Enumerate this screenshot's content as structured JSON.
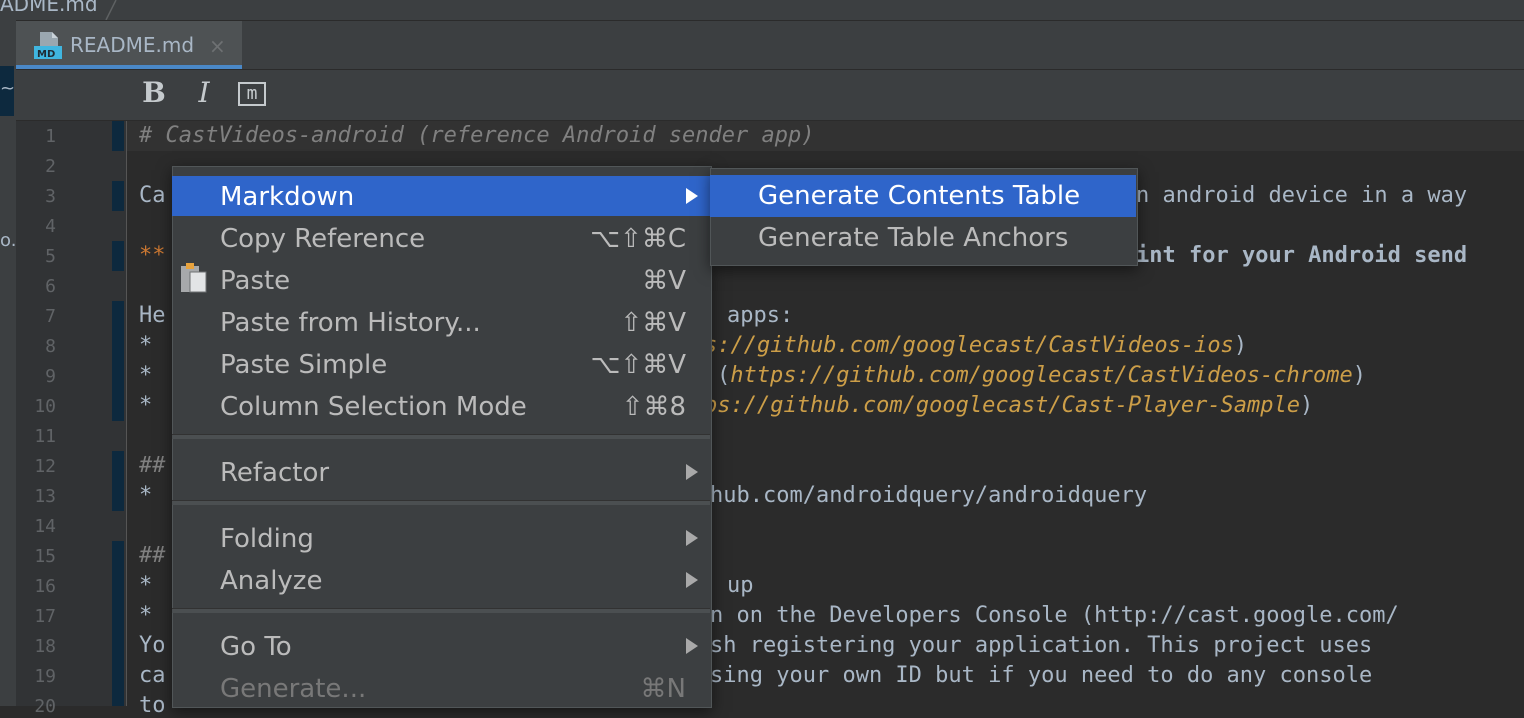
{
  "breadcrumb": {
    "file": "ADME.md"
  },
  "left_strip": {
    "mark1": "~",
    "mark2": "o."
  },
  "tab": {
    "label": "README.md",
    "close": "×",
    "icon": "markdown-file-icon",
    "icon_text": "MD"
  },
  "toolbar": {
    "bold": "B",
    "italic": "I",
    "mono": "m"
  },
  "editor": {
    "line_numbers": [
      "1",
      "2",
      "3",
      "4",
      "5",
      "6",
      "7",
      "8",
      "9",
      "10",
      "11",
      "12",
      "13",
      "14",
      "15",
      "16",
      "17",
      "18",
      "19",
      "20"
    ],
    "lines": [
      {
        "n": 1,
        "segments": [
          {
            "t": "# CastVideos-android (reference Android sender app)",
            "c": "comment"
          }
        ]
      },
      {
        "n": 3,
        "segments": [
          {
            "t": "Ca",
            "c": "plain"
          }
        ]
      },
      {
        "n": 3,
        "right": [
          {
            "t": "n android device in a way",
            "c": "plain"
          }
        ]
      },
      {
        "n": 5,
        "segments": [
          {
            "t": "**",
            "c": "orange"
          }
        ]
      },
      {
        "n": 5,
        "right": [
          {
            "t": "int for your Android send",
            "c": "bold"
          }
        ]
      },
      {
        "n": 7,
        "segments": [
          {
            "t": "He",
            "c": "plain"
          }
        ]
      },
      {
        "n": 7,
        "right": [
          {
            "t": "apps:",
            "c": "plain"
          }
        ]
      },
      {
        "n": 8,
        "segments": [
          {
            "t": "*",
            "c": "plain"
          }
        ]
      },
      {
        "n": 8,
        "right": [
          {
            "t": "s://github.com/googlecast/CastVideos-ios",
            "c": "link"
          },
          {
            "t": ")",
            "c": "plain"
          }
        ]
      },
      {
        "n": 9,
        "segments": [
          {
            "t": "*",
            "c": "plain"
          }
        ]
      },
      {
        "n": 9,
        "right": [
          {
            "t": "(",
            "c": "plain"
          },
          {
            "t": "https://github.com/googlecast/CastVideos-chrome",
            "c": "link"
          },
          {
            "t": ")",
            "c": "plain"
          }
        ]
      },
      {
        "n": 10,
        "segments": [
          {
            "t": "*",
            "c": "plain"
          }
        ]
      },
      {
        "n": 10,
        "right": [
          {
            "t": "ps://github.com/googlecast/Cast-Player-Sample",
            "c": "link"
          },
          {
            "t": ")",
            "c": "plain"
          }
        ]
      },
      {
        "n": 12,
        "segments": [
          {
            "t": "##",
            "c": "comment"
          }
        ]
      },
      {
        "n": 13,
        "segments": [
          {
            "t": "*",
            "c": "plain"
          }
        ]
      },
      {
        "n": 13,
        "right": [
          {
            "t": "hub.com/androidquery/androidquery",
            "c": "plain"
          }
        ]
      },
      {
        "n": 15,
        "segments": [
          {
            "t": "##",
            "c": "comment"
          }
        ]
      },
      {
        "n": 16,
        "segments": [
          {
            "t": "*",
            "c": "plain"
          }
        ]
      },
      {
        "n": 16,
        "right": [
          {
            "t": "up",
            "c": "plain"
          }
        ]
      },
      {
        "n": 17,
        "segments": [
          {
            "t": "*",
            "c": "plain"
          }
        ]
      },
      {
        "n": 17,
        "right": [
          {
            "t": "n on the Developers Console (http://cast.google.com/",
            "c": "plain"
          }
        ]
      },
      {
        "n": 18,
        "segments": [
          {
            "t": "Yo",
            "c": "plain"
          }
        ]
      },
      {
        "n": 18,
        "right": [
          {
            "t": "sh registering your application. This project uses",
            "c": "plain"
          }
        ]
      },
      {
        "n": 19,
        "segments": [
          {
            "t": "ca",
            "c": "plain"
          }
        ]
      },
      {
        "n": 19,
        "right": [
          {
            "t": "sing your own ID but if you need to do any console",
            "c": "plain"
          }
        ]
      },
      {
        "n": 20,
        "segments": [
          {
            "t": "to",
            "c": "plain"
          }
        ]
      }
    ]
  },
  "context_menu": {
    "items": [
      {
        "label": "Markdown",
        "shortcut": "",
        "submenu": true,
        "selected": true
      },
      {
        "label": "Copy Reference",
        "shortcut": "⌥⇧⌘C"
      },
      {
        "label": "Paste",
        "shortcut": "⌘V",
        "icon": "clipboard-paste-icon"
      },
      {
        "label": "Paste from History...",
        "shortcut": "⇧⌘V"
      },
      {
        "label": "Paste Simple",
        "shortcut": "⌥⇧⌘V"
      },
      {
        "label": "Column Selection Mode",
        "shortcut": "⇧⌘8"
      },
      {
        "label": "Refactor",
        "shortcut": "",
        "submenu": true
      },
      {
        "label": "Folding",
        "shortcut": "",
        "submenu": true
      },
      {
        "label": "Analyze",
        "shortcut": "",
        "submenu": true
      },
      {
        "label": "Go To",
        "shortcut": "",
        "submenu": true
      },
      {
        "label": "Generate...",
        "shortcut": "⌘N",
        "disabled": true
      }
    ]
  },
  "submenu": {
    "items": [
      {
        "label": "Generate Contents Table",
        "selected": true
      },
      {
        "label": "Generate Table Anchors"
      }
    ]
  },
  "colors": {
    "accent": "#2f65ca",
    "tab_underline": "#4a88c7",
    "link": "#cc9e48",
    "background": "#2b2b2b"
  }
}
